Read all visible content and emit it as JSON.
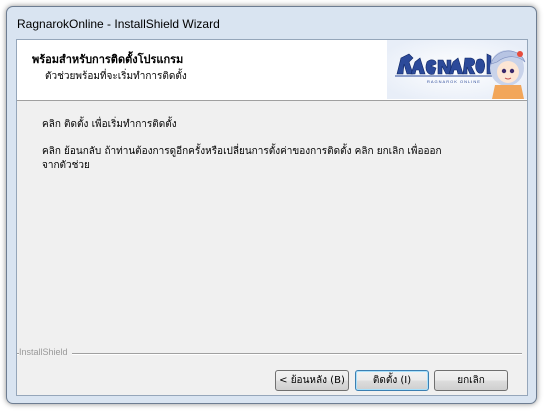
{
  "window": {
    "title": "RagnarokOnline - InstallShield Wizard"
  },
  "header": {
    "title": "พร้อมสำหรับการติดตั้งโปรแกรม",
    "subtitle": "ตัวช่วยพร้อมที่จะเริ่มทำการติดตั้ง",
    "logo_text": "RAGNAROK",
    "logo_subtext": "RAGNAROK ONLINE"
  },
  "body": {
    "line1": "คลิก ติดตั้ง เพื่อเริ่มทำการติดตั้ง",
    "line2a": "คลิก ย้อนกลับ ถ้าท่านต้องการดูอีกครั้งหรือเปลี่ยนการตั้งค่าของการติดตั้ง  คลิก ยกเลิก เพื่อออก",
    "line2b": "จากตัวช่วย"
  },
  "footer": {
    "brand": "InstallShield"
  },
  "buttons": {
    "back": "< ย้อนหลัง (B)",
    "install": "ติดตั้ง (I)",
    "cancel": "ยกเลิก"
  },
  "colors": {
    "frame": "#d9e4f1",
    "client": "#f0f0f0",
    "header_bg": "#ffffff",
    "logo_blue": "#2c4a9a"
  }
}
